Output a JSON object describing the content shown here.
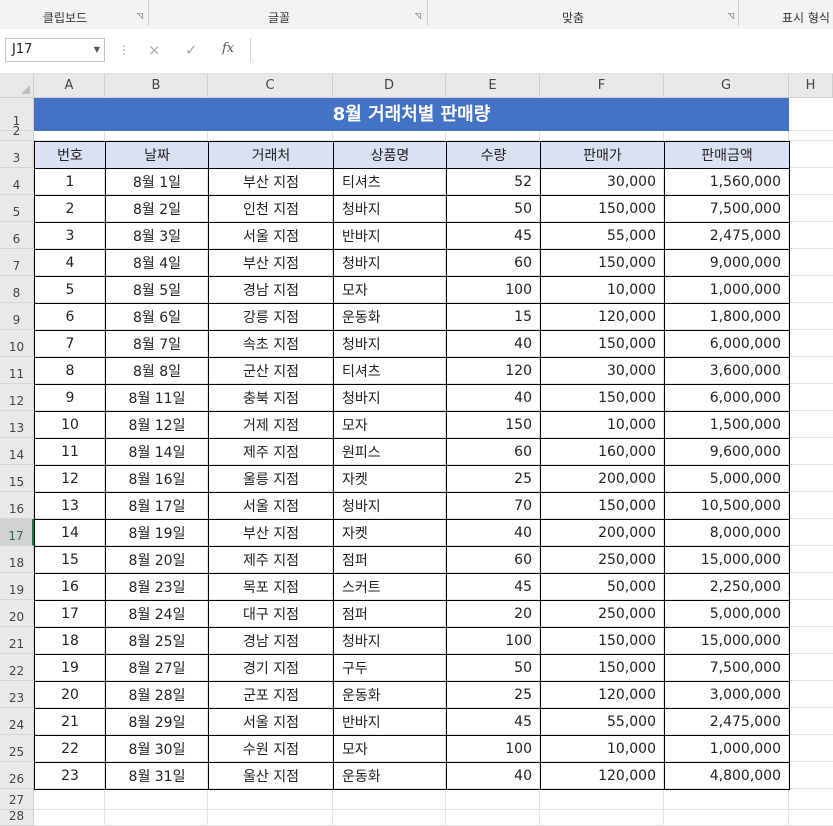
{
  "ribbon": {
    "groups": [
      "클립보드",
      "글꼴",
      "맞춤",
      "표시 형식"
    ]
  },
  "formula_bar": {
    "name_box": "J17",
    "cancel_icon": "×",
    "enter_icon": "✓",
    "fx_label": "fx",
    "formula": ""
  },
  "columns": [
    "A",
    "B",
    "C",
    "D",
    "E",
    "F",
    "G",
    "H"
  ],
  "rows": [
    "1",
    "2",
    "3",
    "4",
    "5",
    "6",
    "7",
    "8",
    "9",
    "10",
    "11",
    "12",
    "13",
    "14",
    "15",
    "16",
    "17",
    "18",
    "19",
    "20",
    "21",
    "22",
    "23",
    "24",
    "25",
    "26",
    "27",
    "28"
  ],
  "active_row": "17",
  "sheet_title": "8월 거래처별 판매량",
  "table": {
    "headers": [
      "번호",
      "날짜",
      "거래처",
      "상품명",
      "수량",
      "판매가",
      "판매금액"
    ],
    "rows": [
      [
        "1",
        "8월 1일",
        "부산 지점",
        "티셔츠",
        "52",
        "30,000",
        "1,560,000"
      ],
      [
        "2",
        "8월 2일",
        "인천 지점",
        "청바지",
        "50",
        "150,000",
        "7,500,000"
      ],
      [
        "3",
        "8월 3일",
        "서울 지점",
        "반바지",
        "45",
        "55,000",
        "2,475,000"
      ],
      [
        "4",
        "8월 4일",
        "부산 지점",
        "청바지",
        "60",
        "150,000",
        "9,000,000"
      ],
      [
        "5",
        "8월 5일",
        "경남 지점",
        "모자",
        "100",
        "10,000",
        "1,000,000"
      ],
      [
        "6",
        "8월 6일",
        "강릉 지점",
        "운동화",
        "15",
        "120,000",
        "1,800,000"
      ],
      [
        "7",
        "8월 7일",
        "속초 지점",
        "청바지",
        "40",
        "150,000",
        "6,000,000"
      ],
      [
        "8",
        "8월 8일",
        "군산 지점",
        "티셔츠",
        "120",
        "30,000",
        "3,600,000"
      ],
      [
        "9",
        "8월 11일",
        "충북 지점",
        "청바지",
        "40",
        "150,000",
        "6,000,000"
      ],
      [
        "10",
        "8월 12일",
        "거제 지점",
        "모자",
        "150",
        "10,000",
        "1,500,000"
      ],
      [
        "11",
        "8월 14일",
        "제주 지점",
        "원피스",
        "60",
        "160,000",
        "9,600,000"
      ],
      [
        "12",
        "8월 16일",
        "울릉 지점",
        "자켓",
        "25",
        "200,000",
        "5,000,000"
      ],
      [
        "13",
        "8월 17일",
        "서울 지점",
        "청바지",
        "70",
        "150,000",
        "10,500,000"
      ],
      [
        "14",
        "8월 19일",
        "부산 지점",
        "자켓",
        "40",
        "200,000",
        "8,000,000"
      ],
      [
        "15",
        "8월 20일",
        "제주 지점",
        "점퍼",
        "60",
        "250,000",
        "15,000,000"
      ],
      [
        "16",
        "8월 23일",
        "목포 지점",
        "스커트",
        "45",
        "50,000",
        "2,250,000"
      ],
      [
        "17",
        "8월 24일",
        "대구 지점",
        "점퍼",
        "20",
        "250,000",
        "5,000,000"
      ],
      [
        "18",
        "8월 25일",
        "경남 지점",
        "청바지",
        "100",
        "150,000",
        "15,000,000"
      ],
      [
        "19",
        "8월 27일",
        "경기 지점",
        "구두",
        "50",
        "150,000",
        "7,500,000"
      ],
      [
        "20",
        "8월 28일",
        "군포 지점",
        "운동화",
        "25",
        "120,000",
        "3,000,000"
      ],
      [
        "21",
        "8월 29일",
        "서울 지점",
        "반바지",
        "45",
        "55,000",
        "2,475,000"
      ],
      [
        "22",
        "8월 30일",
        "수원 지점",
        "모자",
        "100",
        "10,000",
        "1,000,000"
      ],
      [
        "23",
        "8월 31일",
        "울산 지점",
        "운동화",
        "40",
        "120,000",
        "4,800,000"
      ]
    ]
  },
  "colors": {
    "title_bg": "#4472c4",
    "header_bg": "#d9e1f2",
    "selection": "#217346"
  }
}
